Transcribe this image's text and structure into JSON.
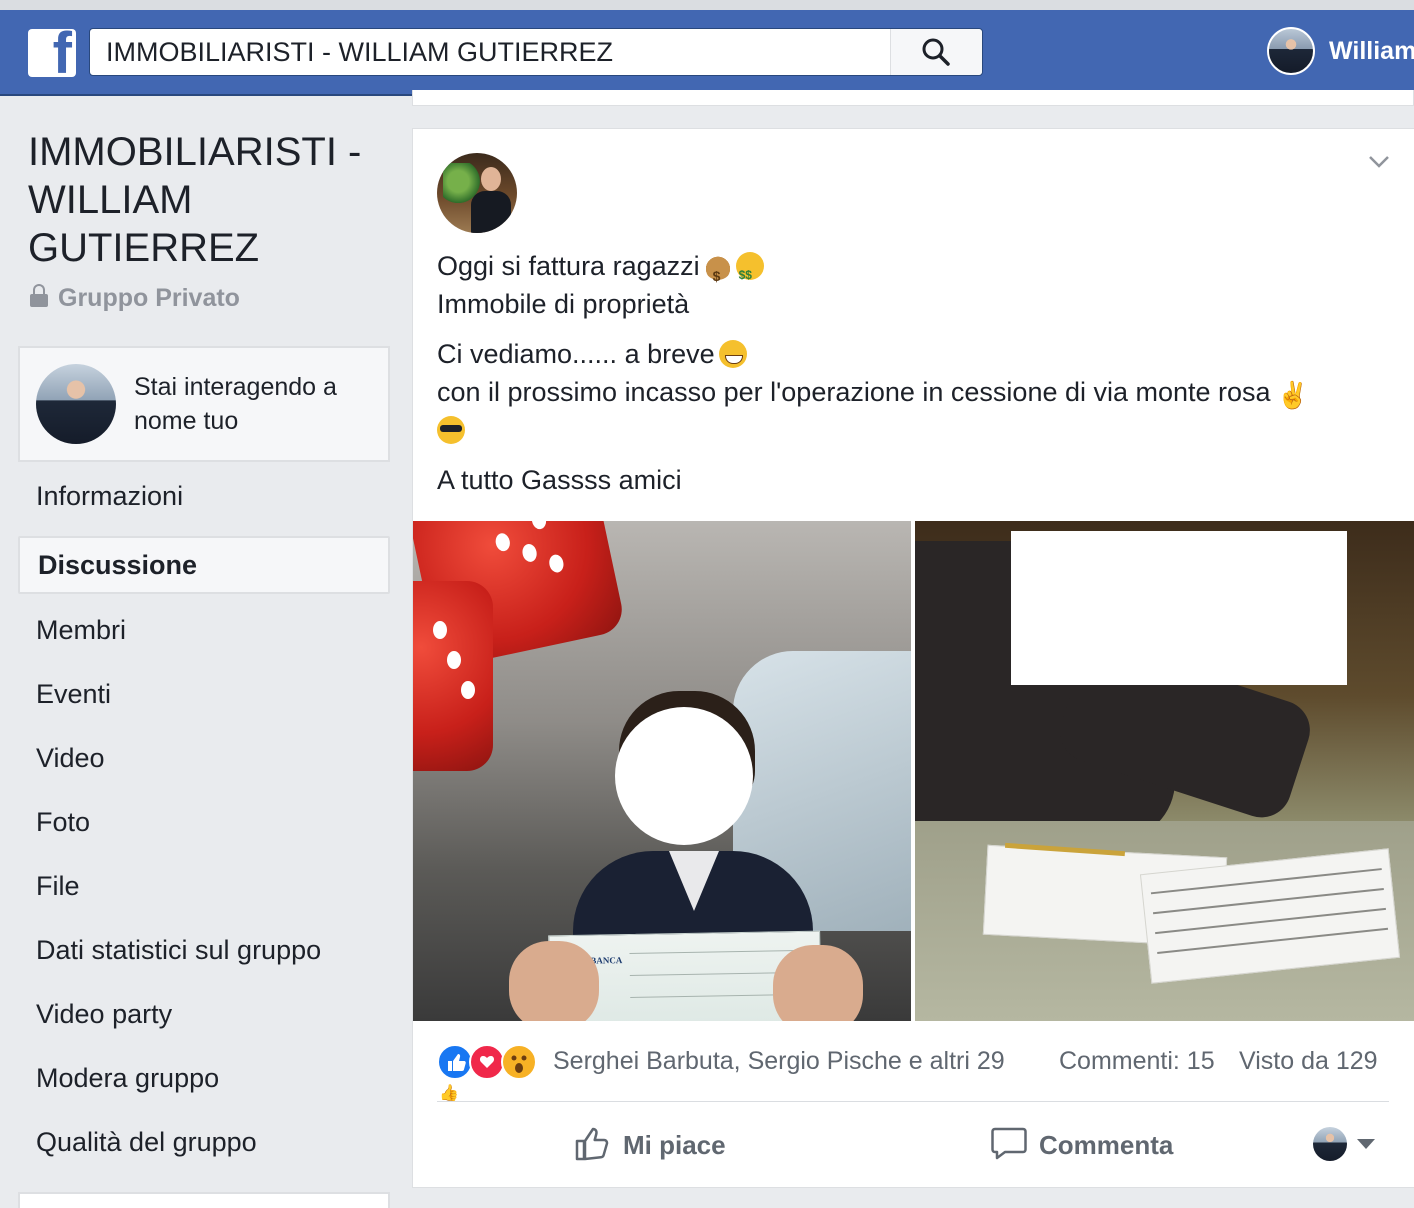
{
  "colors": {
    "brand_blue": "#4267b2",
    "page_bg": "#e9ebee",
    "text_primary": "#1d2129",
    "text_secondary": "#606770",
    "text_muted": "#90949c"
  },
  "header": {
    "logo_icon": "facebook-f-logo",
    "search": {
      "value": "IMMOBILIARISTI - WILLIAM GUTIERREZ",
      "button_icon": "search-icon"
    },
    "user": {
      "name": "William"
    }
  },
  "group": {
    "title": "IMMOBILIARISTI - WILLIAM GUTIERREZ",
    "privacy": "Gruppo Privato",
    "acting_as": "Stai interagendo a nome tuo"
  },
  "nav": {
    "items": [
      {
        "label": "Informazioni",
        "active": false
      },
      {
        "label": "Discussione",
        "active": true
      },
      {
        "label": "Membri",
        "active": false
      },
      {
        "label": "Eventi",
        "active": false
      },
      {
        "label": "Video",
        "active": false
      },
      {
        "label": "Foto",
        "active": false
      },
      {
        "label": "File",
        "active": false
      },
      {
        "label": "Dati statistici sul gruppo",
        "active": false
      },
      {
        "label": "Video party",
        "active": false
      },
      {
        "label": "Modera gruppo",
        "active": false
      },
      {
        "label": "Qualità del gruppo",
        "active": false
      }
    ]
  },
  "post": {
    "options_icon": "chevron-down-icon",
    "lines": {
      "l1": "Oggi si fattura ragazzi",
      "l2": "Immobile di proprietà",
      "l3": "Ci vediamo...... a breve",
      "l4": "con il prossimo incasso per l'operazione in cessione di via monte rosa",
      "l5": "A tutto Gassss amici"
    },
    "cheque_bank": "BIVER BANCA",
    "reactions": {
      "names": "Serghei Barbuta, Sergio Pische e altri 29",
      "comments": "Commenti: 15",
      "views": "Visto da 129"
    },
    "actions": {
      "like": "Mi piace",
      "comment": "Commenta"
    }
  }
}
